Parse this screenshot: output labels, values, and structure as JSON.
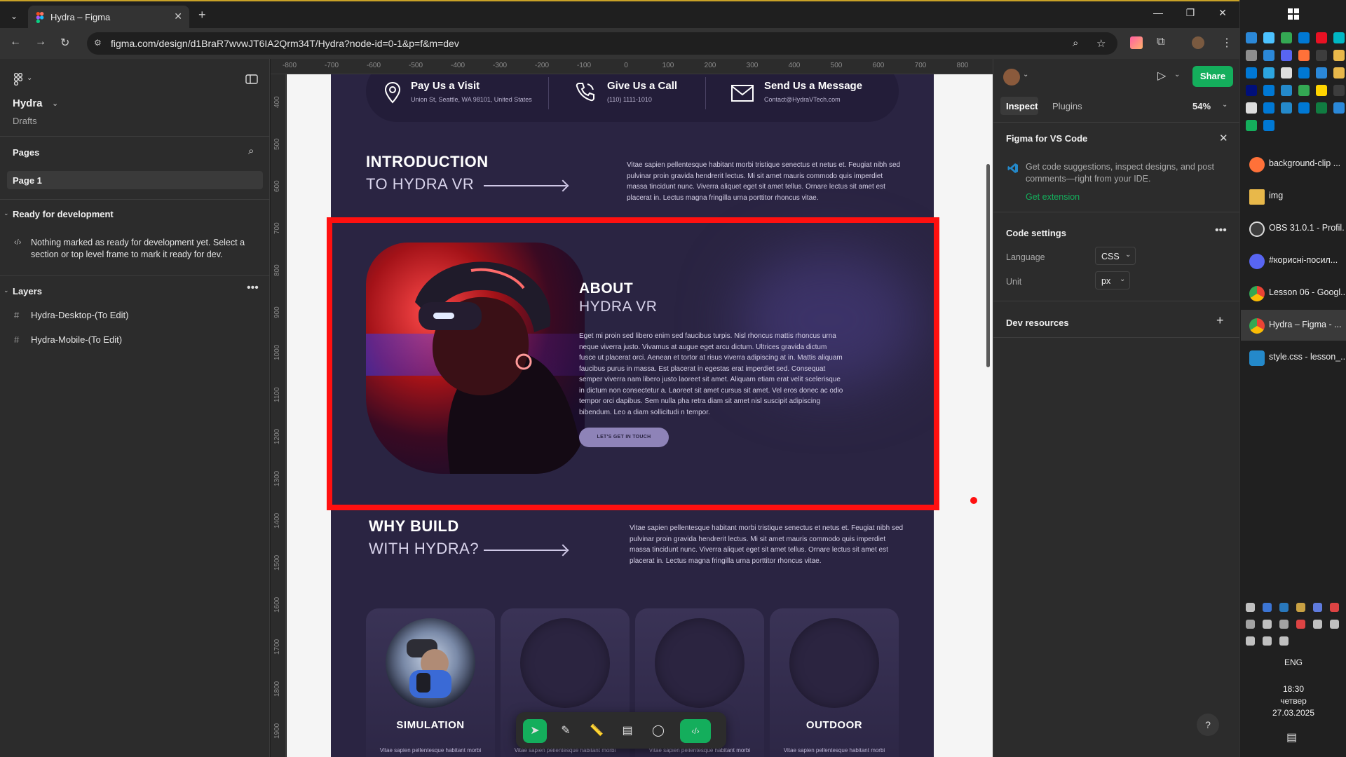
{
  "browser": {
    "tab_title": "Hydra – Figma",
    "url": "figma.com/design/d1BraR7wvwJT6IA2Qrm34T/Hydra?node-id=0-1&p=f&m=dev"
  },
  "figma_left": {
    "project_name": "Hydra",
    "project_location": "Drafts",
    "pages_heading": "Pages",
    "page_item": "Page 1",
    "ready_heading": "Ready for development",
    "ready_message": "Nothing marked as ready for development yet. Select a section or top level frame to mark it ready for dev.",
    "layers_heading": "Layers",
    "layers": [
      "Hydra-Desktop-(To Edit)",
      "Hydra-Mobile-(To Edit)"
    ]
  },
  "ruler": {
    "top": [
      "-800",
      "-700",
      "-600",
      "-500",
      "-400",
      "-300",
      "-200",
      "-100",
      "0",
      "100",
      "200",
      "300",
      "400",
      "500",
      "600",
      "700",
      "800"
    ],
    "left": [
      "400",
      "500",
      "600",
      "700",
      "800",
      "900",
      "1000",
      "1100",
      "1200",
      "1300",
      "1400",
      "1500",
      "1600",
      "1700",
      "1800",
      "1900"
    ]
  },
  "design": {
    "contacts": [
      {
        "title": "Pay Us a Visit",
        "sub": "Union St, Seattle, WA 98101, United States"
      },
      {
        "title": "Give Us a Call",
        "sub": "(110) 1111-1010"
      },
      {
        "title": "Send Us a Message",
        "sub": "Contact@HydraVTech.com"
      }
    ],
    "intro": {
      "line1": "INTRODUCTION",
      "line2": "TO HYDRA VR",
      "text": "Vitae sapien pellentesque habitant morbi tristique senectus et netus et. Feugiat nibh sed pulvinar proin gravida hendrerit lectus. Mi sit amet mauris commodo quis imperdiet massa tincidunt nunc. Viverra aliquet eget sit amet tellus. Ornare lectus sit amet est placerat in. Lectus magna fringilla urna porttitor rhoncus vitae."
    },
    "about": {
      "line1": "ABOUT",
      "line2": "HYDRA VR",
      "text": "Eget mi proin sed libero enim sed faucibus turpis. Nisl rhoncus mattis rhoncus urna neque viverra justo. Vivamus at augue eget arcu dictum. Ultrices gravida dictum fusce ut placerat orci. Aenean et tortor at risus viverra adipiscing at in. Mattis aliquam faucibus purus in massa. Est placerat in egestas erat imperdiet sed. Consequat semper viverra nam libero justo laoreet sit amet. Aliquam etiam erat velit scelerisque in dictum non consectetur a. Laoreet sit amet cursus sit amet. Vel eros donec ac odio tempor orci dapibus. Sem nulla pha retra diam sit amet nisl suscipit adipiscing bibendum. Leo a diam sollicitudi n tempor.",
      "button": "LET'S GET IN TOUCH"
    },
    "why": {
      "line1": "WHY BUILD",
      "line2": "WITH HYDRA?",
      "text": "Vitae sapien pellentesque habitant morbi tristique senectus et netus et. Feugiat nibh sed pulvinar proin gravida hendrerit lectus. Mi sit amet mauris commodo quis imperdiet massa tincidunt nunc. Viverra aliquet eget sit amet tellus. Ornare lectus sit amet est placerat in. Lectus magna fringilla urna porttitor rhoncus vitae."
    },
    "cards": [
      {
        "title": "SIMULATION",
        "text": "Vitae sapien pellentesque habitant morbi"
      },
      {
        "title": "",
        "text": "Vitae sapien pellentesque habitant morbi"
      },
      {
        "title": "",
        "text": "Vitae sapien pellentesque habitant morbi"
      },
      {
        "title": "OUTDOOR",
        "text": "Vitae sapien pellentesque habitant morbi"
      }
    ]
  },
  "figma_right": {
    "share": "Share",
    "tab_inspect": "Inspect",
    "tab_plugins": "Plugins",
    "zoom": "54%",
    "vscode_title": "Figma for VS Code",
    "vscode_desc": "Get code suggestions, inspect designs, and post comments—right from your IDE.",
    "vscode_link": "Get extension",
    "code_settings": "Code settings",
    "language_label": "Language",
    "language_value": "CSS",
    "unit_label": "Unit",
    "unit_value": "px",
    "dev_resources": "Dev resources",
    "help": "?"
  },
  "taskbar": {
    "windows": [
      {
        "label": "background-clip ...",
        "color": "#ff7139"
      },
      {
        "label": "img",
        "color": "#e8b84a"
      },
      {
        "label": "OBS 31.0.1 - Profil...",
        "color": "#3d3d3d"
      },
      {
        "label": "#корисні-посил...",
        "color": "#5865f2"
      },
      {
        "label": "Lesson 06 - Googl...",
        "color": "#4285f4"
      },
      {
        "label": "Hydra – Figma - ...",
        "color": "#4285f4"
      },
      {
        "label": "style.css - lesson_...",
        "color": "#2489ca"
      }
    ],
    "lang": "ENG",
    "time": "18:30",
    "day": "четвер",
    "date": "27.03.2025"
  },
  "colors": {
    "accent_green": "#14ae5c",
    "figma_blue": "#0d99ff",
    "highlight": "#ff1010",
    "design_bg": "#2a2442"
  }
}
